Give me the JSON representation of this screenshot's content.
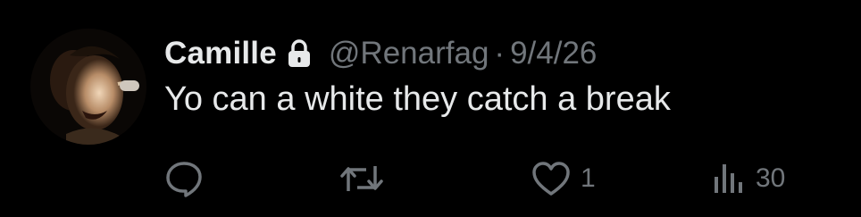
{
  "tweet": {
    "display_name": "Camille",
    "handle": "@Renarfag",
    "separator": "·",
    "date": "9/4/26",
    "text": "Yo can a white they catch a break",
    "protected": true
  },
  "actions": {
    "reply": {
      "icon": "reply-icon",
      "count": ""
    },
    "retweet": {
      "icon": "retweet-icon",
      "count": ""
    },
    "like": {
      "icon": "heart-icon",
      "count": "1"
    },
    "views": {
      "icon": "views-icon",
      "count": "30"
    }
  },
  "colors": {
    "background": "#000000",
    "primary_text": "#e7e9ea",
    "secondary_text": "#71767b"
  }
}
